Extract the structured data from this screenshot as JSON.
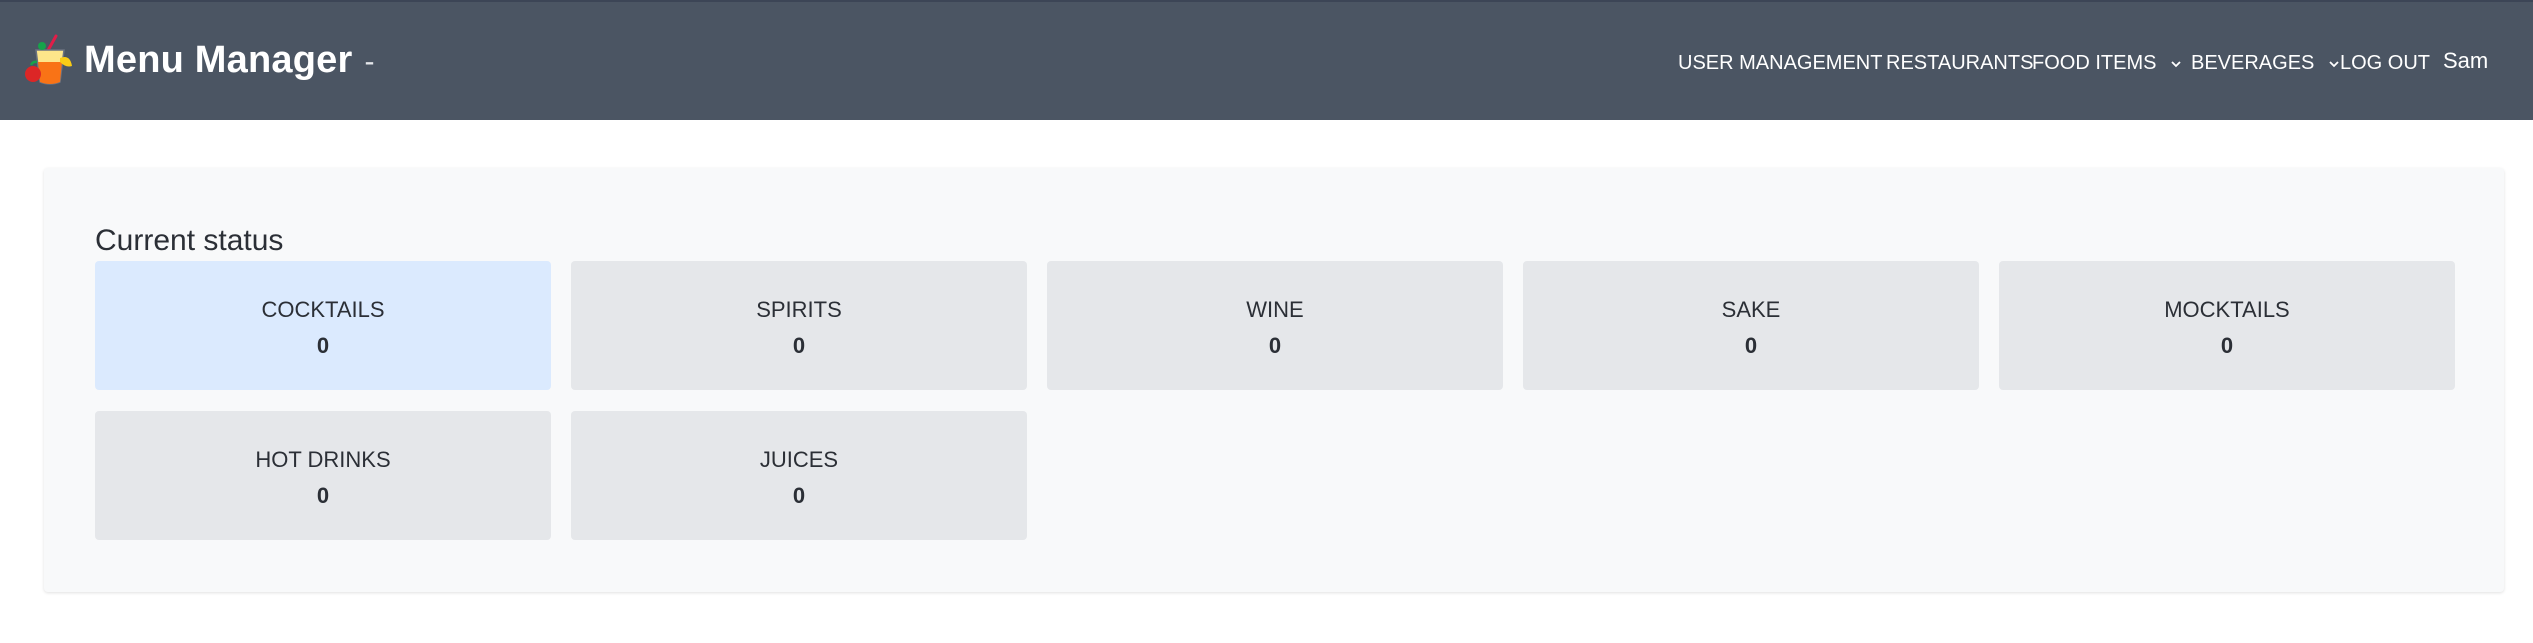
{
  "brand": {
    "title": "Menu Manager",
    "separator": "-",
    "logo_icon": "cocktail-logo-icon"
  },
  "nav": {
    "user_management": "USER MANAGEMENT",
    "restaurants": "RESTAURANTS",
    "food_items": "FOOD ITEMS",
    "beverages": "BEVERAGES",
    "log_out": "LOG OUT",
    "user": "Sam"
  },
  "status": {
    "title": "Current status",
    "cards": [
      {
        "label": "COCKTAILS",
        "count": "0",
        "selected": true
      },
      {
        "label": "SPIRITS",
        "count": "0"
      },
      {
        "label": "WINE",
        "count": "0"
      },
      {
        "label": "SAKE",
        "count": "0"
      },
      {
        "label": "MOCKTAILS",
        "count": "0"
      },
      {
        "label": "HOT DRINKS",
        "count": "0"
      },
      {
        "label": "JUICES",
        "count": "0"
      }
    ]
  },
  "colors": {
    "navbar": "#4b5563",
    "card": "#e5e7ea",
    "card_selected": "#dbeafe",
    "panel": "#f8f9fa"
  }
}
